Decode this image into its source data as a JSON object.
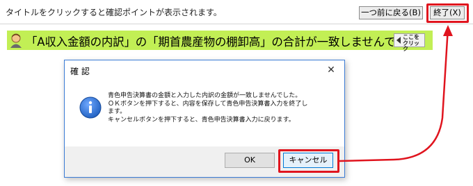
{
  "top": {
    "instruction": "タイトルをクリックすると確認ポイントが表示されます。",
    "back_button": "一つ前に戻る(B)",
    "exit_button": "終了(X)"
  },
  "message_bar": {
    "text": "「A収入金額の内訳」の「期首農産物の棚卸高」の合計が一致しませんでした。",
    "here_button": "ここを\nクリック",
    "person_icon": "person-icon"
  },
  "dialog": {
    "title": "確 認",
    "close_glyph": "✕",
    "icon": "info-icon",
    "message_lines": [
      "青色申告決算書の金額と入力した内訳の金額が一致しませんでした。",
      "ＯＫボタンを押下すると、内容を保存して青色申告決算書入力を終了し",
      "ます。",
      "キャンセルボタンを押下すると、青色申告決算書入力に戻ります。"
    ],
    "ok_button": "OK",
    "cancel_button": "キャンセル"
  },
  "colors": {
    "highlight": "#e0141e",
    "message_bar_bg": "#c2ef55",
    "dialog_border": "#3a7bd5",
    "info_icon": "#1f5fbf"
  }
}
